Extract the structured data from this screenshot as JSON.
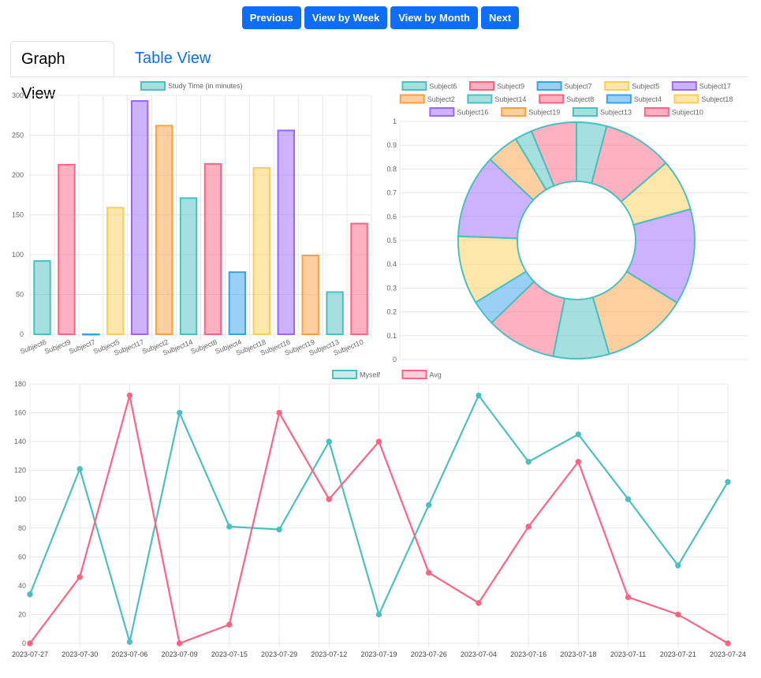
{
  "nav": {
    "previous": "Previous",
    "week": "View by Week",
    "month": "View by Month",
    "next": "Next"
  },
  "tabs": {
    "graph": "Graph View",
    "table": "Table View"
  },
  "colors": {
    "teal": "#4bc0c0",
    "pink": "#ff6384",
    "blue": "#36a2eb",
    "yellow": "#ffcd56",
    "purple": "#9966ff",
    "orange": "#ff9f40"
  },
  "chart_data": [
    {
      "type": "bar",
      "legend": "Study Time (in minutes)",
      "categories": [
        "Subject6",
        "Subject9",
        "Subject7",
        "Subject5",
        "Subject17",
        "Subject2",
        "Subject14",
        "Subject8",
        "Subject4",
        "Subject18",
        "Subject16",
        "Subject19",
        "Subject13",
        "Subject10"
      ],
      "values": [
        92,
        213,
        0,
        159,
        293,
        262,
        171,
        214,
        78,
        209,
        256,
        99,
        53,
        139
      ],
      "colors": [
        "teal",
        "pink",
        "blue",
        "yellow",
        "purple",
        "orange",
        "teal",
        "pink",
        "blue",
        "yellow",
        "purple",
        "orange",
        "teal",
        "pink"
      ],
      "ylim": [
        0,
        300
      ],
      "yticks": [
        0,
        50,
        100,
        150,
        200,
        250,
        300
      ]
    },
    {
      "type": "pie",
      "variant": "doughnut",
      "labels": [
        "Subject6",
        "Subject9",
        "Subject7",
        "Subject5",
        "Subject17",
        "Subject2",
        "Subject14",
        "Subject8",
        "Subject4",
        "Subject18",
        "Subject16",
        "Subject19",
        "Subject13",
        "Subject10"
      ],
      "values": [
        92,
        213,
        0,
        159,
        293,
        262,
        171,
        214,
        78,
        209,
        256,
        99,
        53,
        139
      ],
      "colors": [
        "teal",
        "pink",
        "blue",
        "yellow",
        "purple",
        "orange",
        "teal",
        "pink",
        "blue",
        "yellow",
        "purple",
        "orange",
        "teal",
        "pink"
      ],
      "yticks": [
        "0",
        "0.1",
        "0.2",
        "0.3",
        "0.4",
        "0.5",
        "0.6",
        "0.7",
        "0.8",
        "0.9",
        "1"
      ]
    },
    {
      "type": "line",
      "x": [
        "2023-07-27",
        "2023-07-30",
        "2023-07-06",
        "2023-07-09",
        "2023-07-15",
        "2023-07-29",
        "2023-07-12",
        "2023-07-19",
        "2023-07-26",
        "2023-07-04",
        "2023-07-16",
        "2023-07-18",
        "2023-07-11",
        "2023-07-21",
        "2023-07-24"
      ],
      "series": [
        {
          "name": "Myself",
          "color": "teal",
          "values": [
            34,
            121,
            1,
            160,
            81,
            79,
            140,
            20,
            96,
            172,
            126,
            145,
            100,
            54,
            112
          ]
        },
        {
          "name": "Avg",
          "color": "pink",
          "values": [
            0,
            46,
            172,
            0,
            13,
            160,
            100,
            140,
            49,
            28,
            81,
            126,
            32,
            20,
            0
          ]
        }
      ],
      "ylim": [
        0,
        180
      ],
      "yticks": [
        0,
        20,
        40,
        60,
        80,
        100,
        120,
        140,
        160,
        180
      ]
    }
  ]
}
